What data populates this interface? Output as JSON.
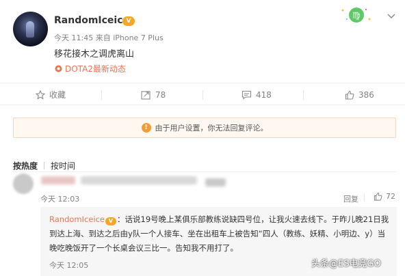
{
  "post": {
    "username": "RandomIceice",
    "badge": "V",
    "meta": "今天 11:45 来自 iPhone 7 Plus",
    "content": "移花接木之调虎离山",
    "topic": "DOTA2最新动态"
  },
  "actions": {
    "favorite": "收藏",
    "repost": "78",
    "comment": "418",
    "like": "386"
  },
  "notice": {
    "text": "由于用户设置，你无法回复评论。",
    "icon": "!"
  },
  "sort": {
    "hot": "按热度",
    "time": "按时间"
  },
  "comment": {
    "time": "今天 12:03",
    "reply": "回复",
    "likes": "72"
  },
  "reply": {
    "username": "RandomIceice",
    "badge": "V",
    "text": "：话说19号晚上某俱乐部教练说缺四号位，让我火速去线下。于昨儿晚21日我到达上海、到达之后由y队一个人接车、坐在出租车上被告知“四人（教练、妖精、小明边、y）当晚吃晚饭开了一个长桌会议三比一。告知我不用打了。",
    "time": "今天 12:05"
  },
  "watermark": "头条@ES电竞GO",
  "colors": {
    "accent": "#eb7350",
    "muted": "#808080",
    "notice_bg": "#fff8f0"
  }
}
